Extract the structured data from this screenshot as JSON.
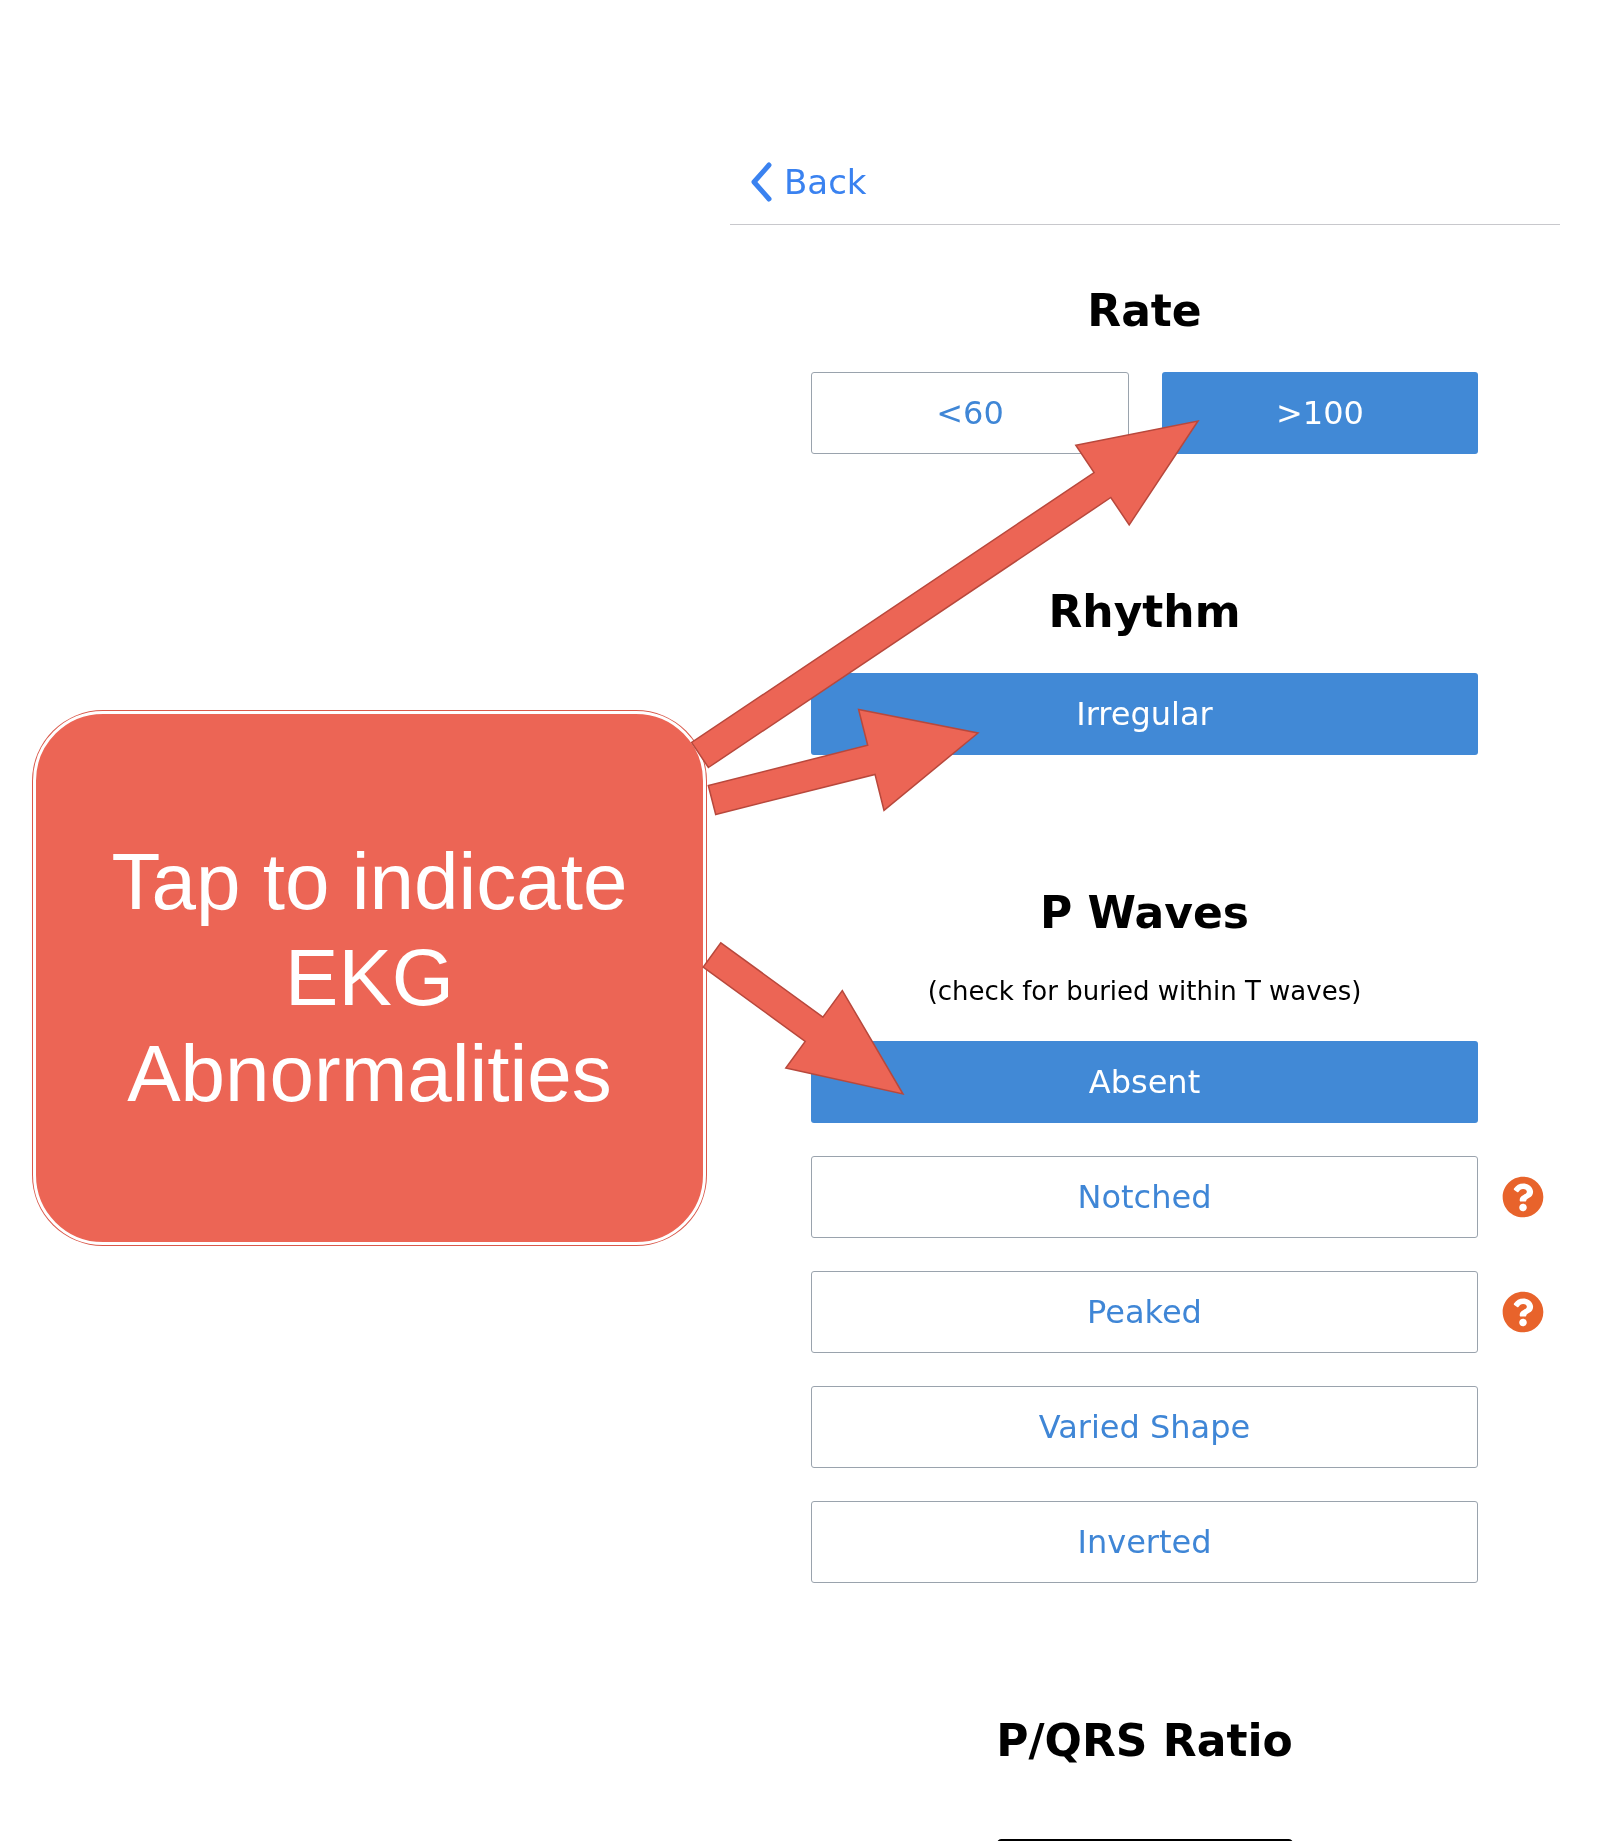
{
  "nav": {
    "back": "Back"
  },
  "sections": [
    {
      "title": "Rate",
      "kind": "row",
      "options": [
        {
          "label": "<60",
          "selected": false
        },
        {
          "label": ">100",
          "selected": true
        }
      ]
    },
    {
      "title": "Rhythm",
      "kind": "column",
      "options": [
        {
          "label": "Irregular",
          "selected": true,
          "help": false
        }
      ]
    },
    {
      "title": "P Waves",
      "subtitle": "(check for buried within T waves)",
      "kind": "column",
      "options": [
        {
          "label": "Absent",
          "selected": true,
          "help": false
        },
        {
          "label": "Notched",
          "selected": false,
          "help": true
        },
        {
          "label": "Peaked",
          "selected": false,
          "help": true
        },
        {
          "label": "Varied Shape",
          "selected": false,
          "help": false
        },
        {
          "label": "Inverted",
          "selected": false,
          "help": false
        }
      ]
    }
  ],
  "next_heading": "P/QRS Ratio",
  "callout": {
    "text": "Tap to indicate EKG Abnormalities"
  }
}
